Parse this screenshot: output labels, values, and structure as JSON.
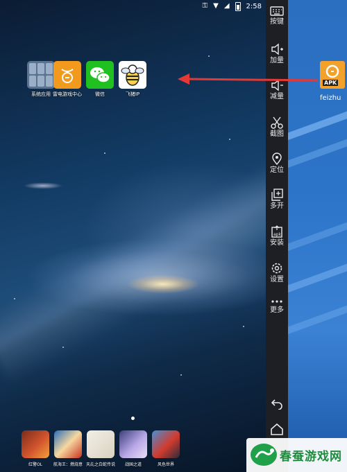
{
  "status_bar": {
    "time": "2:58"
  },
  "desktop_apps": [
    {
      "id": "system",
      "label": "系统应用"
    },
    {
      "id": "leidian",
      "label": "雷电游戏中心"
    },
    {
      "id": "wechat",
      "label": "微信"
    },
    {
      "id": "feizhu",
      "label": "飞猪IP"
    }
  ],
  "dock_apps": [
    {
      "label": "红警OL"
    },
    {
      "label": "航海王：燃烧意"
    },
    {
      "label": "天乩之白蛇传说"
    },
    {
      "label": "战国之道"
    },
    {
      "label": "风色世界"
    }
  ],
  "sidebar": {
    "buttons": [
      {
        "icon": "keyboard-icon",
        "label": "按键"
      },
      {
        "icon": "volume-up-icon",
        "label": "加量"
      },
      {
        "icon": "volume-down-icon",
        "label": "减量"
      },
      {
        "icon": "scissors-icon",
        "label": "截图"
      },
      {
        "icon": "location-icon",
        "label": "定位"
      },
      {
        "icon": "multi-window-icon",
        "label": "多开"
      },
      {
        "icon": "apk-install-icon",
        "label": "安装"
      },
      {
        "icon": "gear-icon",
        "label": "设置"
      },
      {
        "icon": "more-icon",
        "label": "更多"
      }
    ],
    "nav_icons": [
      "back-icon",
      "home-icon"
    ]
  },
  "apk_file": {
    "badge": "APK",
    "label": "feizhu"
  },
  "watermark": {
    "text": "春蚕游戏网"
  },
  "colors": {
    "arrow": "#e53935",
    "sidebar_bg": "#1d1f24"
  }
}
